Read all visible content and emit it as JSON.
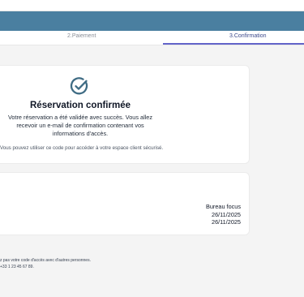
{
  "stepper": {
    "payment_label": "2.Paiement",
    "confirmation_label": "3.Confirmation"
  },
  "confirmation": {
    "title": "Réservation confirmée",
    "message_lines": [
      "Votre réservation a été validée avec succès. Vous allez",
      "recevoir un e-mail de confirmation contenant vos",
      "informations d'accès."
    ],
    "code_note": "Vous pouvez utiliser ce code pour accéder à votre espace client sécurisé."
  },
  "details": {
    "office": "Bureau focus",
    "start_date": "26/11/2025",
    "end_date": "26/11/2025"
  },
  "footer": {
    "line1": "z pas votre code d'accès avec d'autres personnes.",
    "line2": "+33 1 23 45 67 89."
  },
  "colors": {
    "banner": "#4a7fa0",
    "accent": "#6264c9",
    "check": "#3f6c84"
  },
  "icons": {
    "check": "check-circle-icon"
  }
}
